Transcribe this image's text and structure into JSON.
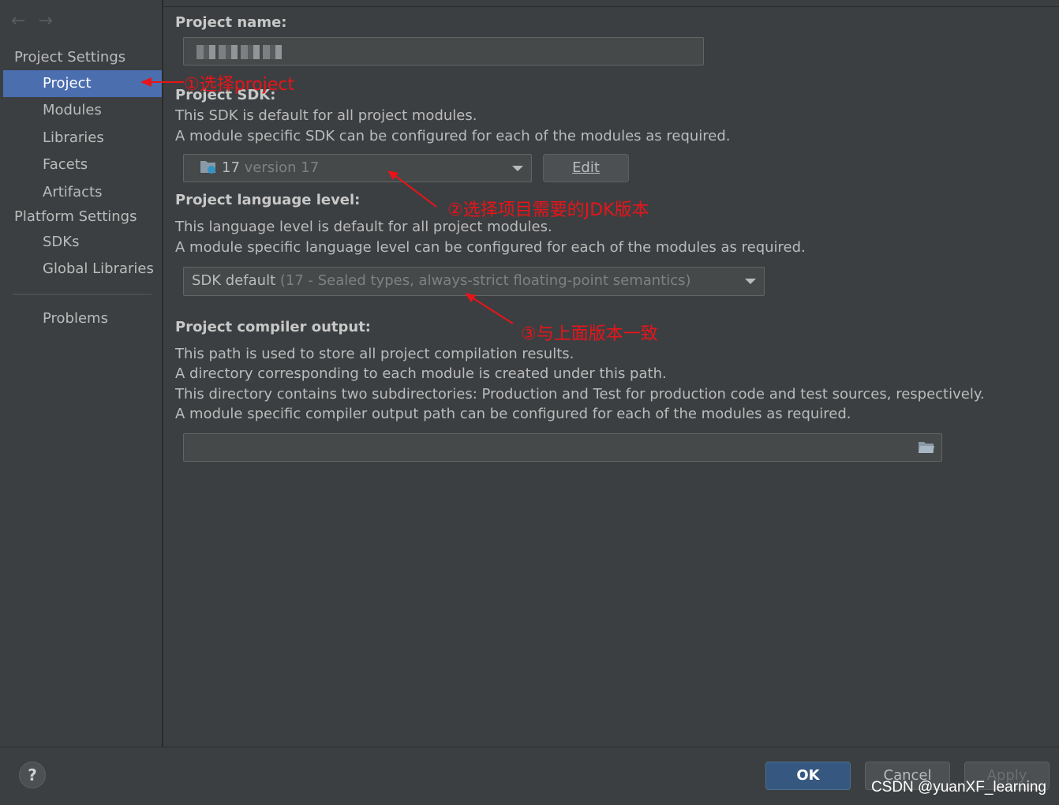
{
  "nav": {
    "back": "←",
    "forward": "→"
  },
  "sidebar": {
    "project_settings_header": "Project Settings",
    "project_items": [
      "Project",
      "Modules",
      "Libraries",
      "Facets",
      "Artifacts"
    ],
    "platform_settings_header": "Platform Settings",
    "platform_items": [
      "SDKs",
      "Global Libraries"
    ],
    "problems": "Problems",
    "selected": "Project"
  },
  "main": {
    "project_name": {
      "label": "Project name:"
    },
    "sdk": {
      "label": "Project SDK:",
      "desc1": "This SDK is default for all project modules.",
      "desc2": "A module specific SDK can be configured for each of the modules as required.",
      "value_main": "17",
      "value_muted": "version 17",
      "edit_button": "Edit"
    },
    "language_level": {
      "label": "Project language level:",
      "desc1": "This language level is default for all project modules.",
      "desc2": "A module specific language level can be configured for each of the modules as required.",
      "value_main": "SDK default",
      "value_muted": "(17 - Sealed types, always-strict floating-point semantics)"
    },
    "compiler_output": {
      "label": "Project compiler output:",
      "desc1": "This path is used to store all project compilation results.",
      "desc2": "A directory corresponding to each module is created under this path.",
      "desc3": "This directory contains two subdirectories: Production and Test for production code and test sources, respectively.",
      "desc4": "A module specific compiler output path can be configured for each of the modules as required.",
      "value": ""
    }
  },
  "annotations": {
    "a1": "①选择project",
    "a2": "②选择项目需要的JDK版本",
    "a3": "③与上面版本一致",
    "color": "#e8141a"
  },
  "footer": {
    "help": "?",
    "ok": "OK",
    "cancel": "Cancel",
    "apply": "Apply",
    "watermark": "CSDN @yuanXF_learning"
  },
  "colors": {
    "background": "#3c3f41",
    "selection": "#4b6eaf",
    "ok_button": "#365880"
  }
}
